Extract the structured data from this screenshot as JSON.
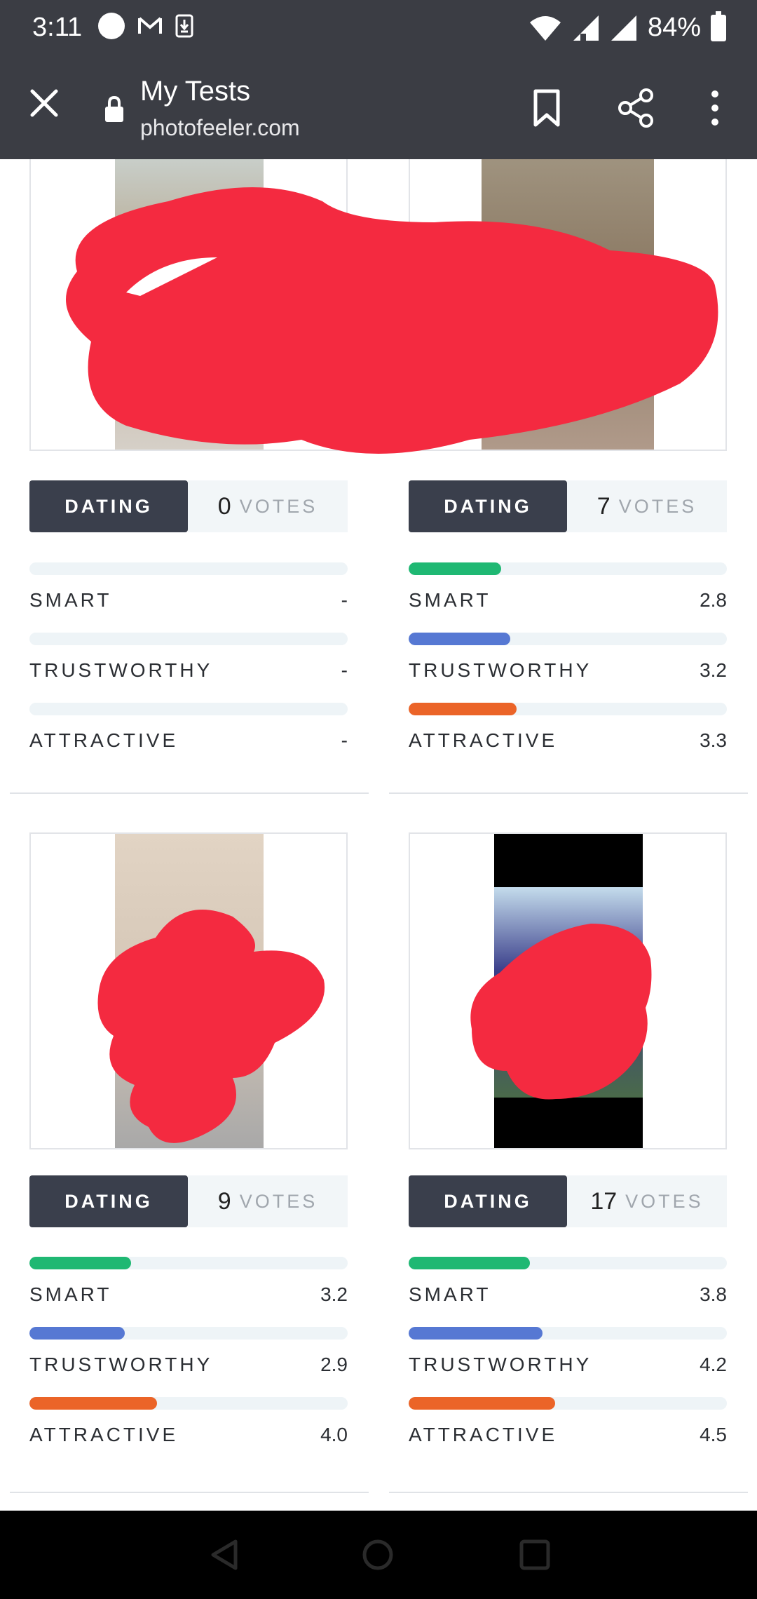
{
  "status_bar": {
    "time": "3:11",
    "battery": "84%",
    "icons": [
      "circle-icon",
      "gmail-icon",
      "download-icon",
      "wifi-icon",
      "signal-icon",
      "battery-icon"
    ]
  },
  "toolbar": {
    "title": "My Tests",
    "url": "photofeeler.com",
    "icons": [
      "close-icon",
      "lock-icon",
      "bookmark-icon",
      "share-icon",
      "more-vert-icon"
    ]
  },
  "colors": {
    "smart": "#1fb873",
    "trustworthy": "#5678d3",
    "attractive": "#eb6428",
    "badge_bg": "#3a3f4c",
    "toolbar_bg": "#3b3d44",
    "redaction": "#f42a40"
  },
  "tests": [
    {
      "category": "DATING",
      "votes": "0",
      "votes_label": "VOTES",
      "metrics": [
        {
          "name": "SMART",
          "value": "-",
          "fill": 0
        },
        {
          "name": "TRUSTWORTHY",
          "value": "-",
          "fill": 0
        },
        {
          "name": "ATTRACTIVE",
          "value": "-",
          "fill": 0
        }
      ]
    },
    {
      "category": "DATING",
      "votes": "7",
      "votes_label": "VOTES",
      "metrics": [
        {
          "name": "SMART",
          "value": "2.8",
          "fill": 0.29
        },
        {
          "name": "TRUSTWORTHY",
          "value": "3.2",
          "fill": 0.32
        },
        {
          "name": "ATTRACTIVE",
          "value": "3.3",
          "fill": 0.34
        }
      ]
    },
    {
      "category": "DATING",
      "votes": "9",
      "votes_label": "VOTES",
      "metrics": [
        {
          "name": "SMART",
          "value": "3.2",
          "fill": 0.32
        },
        {
          "name": "TRUSTWORTHY",
          "value": "2.9",
          "fill": 0.3
        },
        {
          "name": "ATTRACTIVE",
          "value": "4.0",
          "fill": 0.4
        }
      ]
    },
    {
      "category": "DATING",
      "votes": "17",
      "votes_label": "VOTES",
      "metrics": [
        {
          "name": "SMART",
          "value": "3.8",
          "fill": 0.38
        },
        {
          "name": "TRUSTWORTHY",
          "value": "4.2",
          "fill": 0.42
        },
        {
          "name": "ATTRACTIVE",
          "value": "4.5",
          "fill": 0.46
        }
      ]
    }
  ],
  "nav_bar": {
    "icons": [
      "back-icon",
      "home-icon",
      "recents-icon"
    ]
  }
}
